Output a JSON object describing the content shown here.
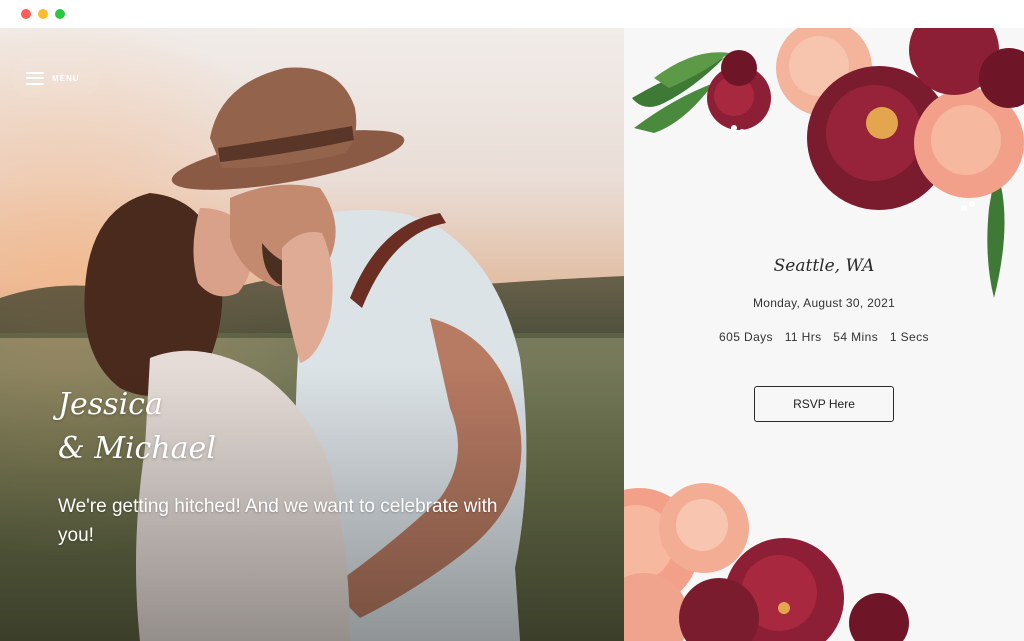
{
  "window": {
    "controls": [
      "close",
      "minimize",
      "maximize"
    ]
  },
  "hero": {
    "menu_label": "MENU",
    "names_line1": "Jessica",
    "names_line2": "& Michael",
    "tagline": "We're getting hitched! And we want to celebrate with you!"
  },
  "invite": {
    "location": "Seattle, WA",
    "date": "Monday, August 30, 2021",
    "countdown": {
      "days": "605 Days",
      "hours": "11 Hrs",
      "minutes": "54 Mins",
      "seconds": "1 Secs"
    },
    "rsvp_label": "RSVP Here"
  },
  "colors": {
    "accent_burgundy": "#7a1b2e",
    "accent_peach": "#f2a08a",
    "leaf_green": "#3e7a35",
    "panel_bg": "#f8f7f7"
  }
}
